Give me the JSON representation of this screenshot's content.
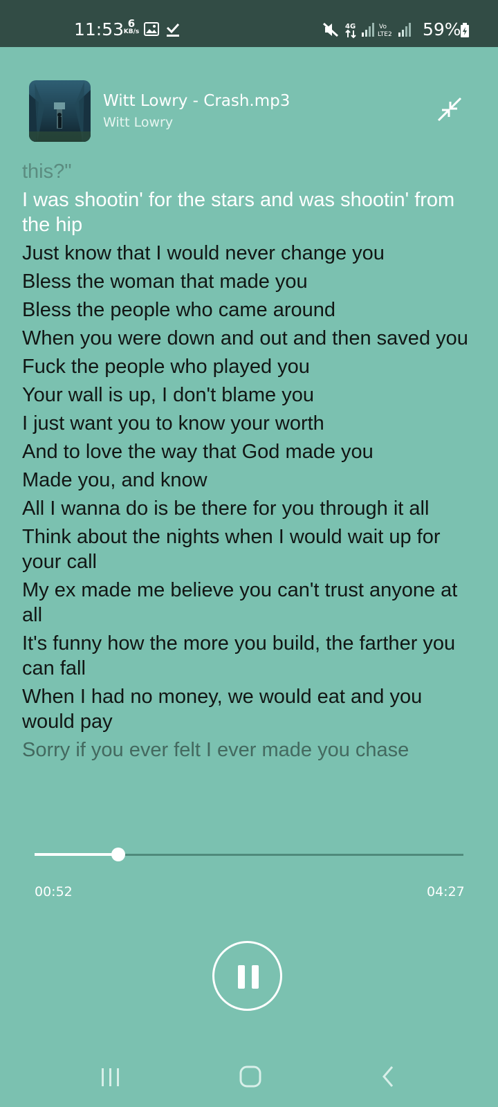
{
  "status_bar": {
    "time": "11:53",
    "net_speed_value": "6",
    "net_speed_unit": "KB/s",
    "battery": "59%",
    "icons": [
      "gallery-icon",
      "check-download-icon",
      "mute-icon",
      "4g-data-icon",
      "signal-icon",
      "volte-icon",
      "signal-icon",
      "battery-icon"
    ]
  },
  "player": {
    "title": "Witt Lowry - Crash.mp3",
    "artist": "Witt Lowry"
  },
  "lyrics": {
    "previous": "this?\"",
    "current": "I was shootin' for the stars and was shootin' from the hip",
    "upcoming": [
      "Just know that I would never change you",
      "Bless the woman that made you",
      "Bless the people who came around",
      "When you were down and out and then saved you",
      "Fuck the people who played you",
      "Your wall is up, I don't blame you",
      "I just want you to know your worth",
      "And to love the way that God made you",
      "Made you, and know",
      "All I wanna do is be there for you through it all",
      "Think about the nights when I would wait up for your call",
      "My ex made me believe you can't trust anyone at all",
      "It's funny how the more you build, the farther you can fall",
      "When I had no money, we would eat and you would pay"
    ],
    "next_faded": "Sorry if you ever felt I ever made you chase"
  },
  "progress": {
    "elapsed": "00:52",
    "total": "04:27",
    "fraction": 0.195
  },
  "controls": {
    "play_state_icon": "pause-icon"
  },
  "colors": {
    "background": "#7bc1b0",
    "status_bar": "#324c45",
    "accent": "#ffffff"
  }
}
